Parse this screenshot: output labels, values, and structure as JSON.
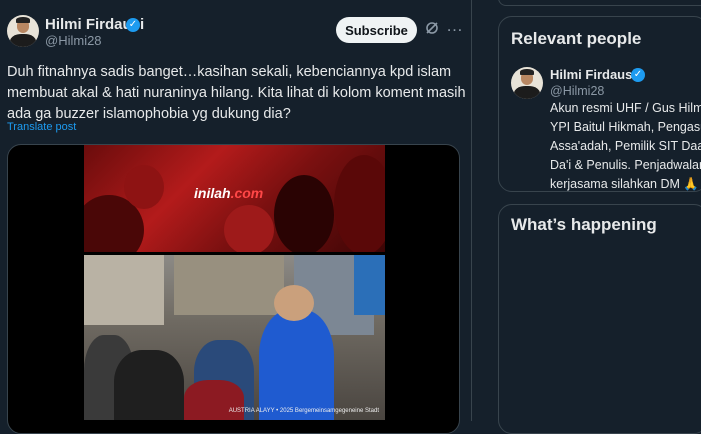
{
  "tweet": {
    "author_name": "Hilmi Firdausi",
    "author_handle": "@Hilmi28",
    "subscribe_label": "Subscribe",
    "more_label": "…",
    "text": "Duh fitnahnya sadis banget…kasihan sekali, kebenciannya kpd islam membuat akal & hati nuraninya hilang. Kita lihat di kolom koment masih ada ga buzzer islamophobia yg dukung dia?",
    "translate_label": "Translate post",
    "media": {
      "watermark": "inilah",
      "watermark_suffix": ".com",
      "caption_small": "AUSTRIA ALAYY • 2025\nBergemeinsamgegeneine Stadt"
    }
  },
  "sidebar": {
    "relevant_title": "Relevant people",
    "person": {
      "name": "Hilmi Firdausi",
      "handle": "@Hilmi28",
      "bio_lines": [
        "Akun resmi UHF / Gus Hilmi",
        "YPI Baitul Hikmah, Pengasu",
        "Assa'adah, Pemilik SIT Daar",
        "Da'i & Penulis. Penjadwalan",
        "kerjasama silahkan DM 🙏"
      ]
    },
    "happening_title": "What’s happening"
  },
  "icons": {
    "verified": "verified-badge-icon",
    "grok": "grok-icon",
    "more": "more-icon"
  },
  "colors": {
    "background": "#15202b",
    "accent": "#1d9bf0",
    "text": "#e7e9ea",
    "muted": "#8b98a5"
  }
}
